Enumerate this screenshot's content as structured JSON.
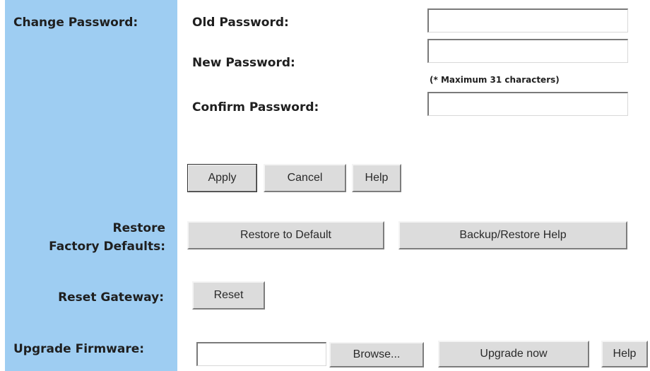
{
  "sections": {
    "change_password": {
      "label": "Change Password:",
      "old_password_label": "Old Password:",
      "new_password_label": "New Password:",
      "confirm_password_label": "Confirm Password:",
      "max_note": "(* Maximum 31 characters)",
      "old_password_value": "",
      "new_password_value": "",
      "confirm_password_value": "",
      "buttons": {
        "apply": "Apply",
        "cancel": "Cancel",
        "help": "Help"
      }
    },
    "restore": {
      "label_line1": "Restore",
      "label_line2": "Factory Defaults:",
      "restore_button": "Restore to Default",
      "backup_help_button": "Backup/Restore Help"
    },
    "reset": {
      "label": "Reset Gateway:",
      "reset_button": "Reset"
    },
    "upgrade": {
      "label": "Upgrade Firmware:",
      "file_value": "",
      "browse_button": "Browse...",
      "upgrade_button": "Upgrade now",
      "help_button": "Help"
    }
  },
  "colors": {
    "sidebar": "#9ecdf2",
    "button_face": "#dcdcdc"
  }
}
